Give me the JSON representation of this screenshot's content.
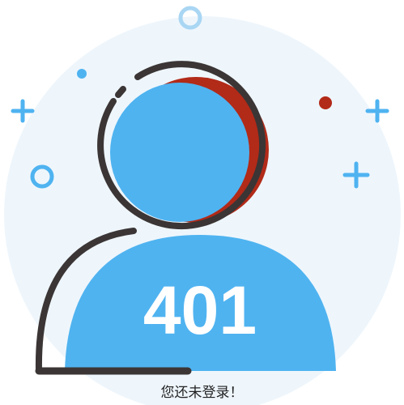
{
  "illustration": {
    "code": "401",
    "colors": {
      "blue": "#4fb3f0",
      "outline": "#3b3535",
      "red": "#b22a18",
      "bg": "#eef6fc"
    }
  },
  "message": "您还未登录！"
}
